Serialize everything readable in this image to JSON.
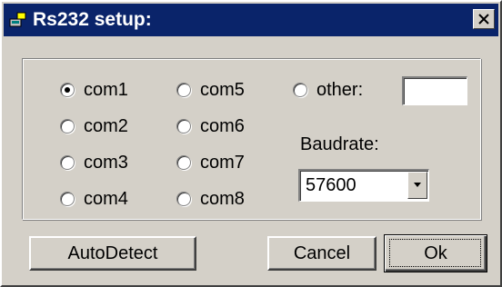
{
  "window": {
    "title": "Rs232 setup:",
    "icon": "serial-port-icon",
    "close_icon": "close-icon"
  },
  "ports": {
    "options": [
      {
        "label": "com1",
        "selected": true
      },
      {
        "label": "com2",
        "selected": false
      },
      {
        "label": "com3",
        "selected": false
      },
      {
        "label": "com4",
        "selected": false
      },
      {
        "label": "com5",
        "selected": false
      },
      {
        "label": "com6",
        "selected": false
      },
      {
        "label": "com7",
        "selected": false
      },
      {
        "label": "com8",
        "selected": false
      }
    ],
    "other": {
      "label": "other:",
      "selected": false,
      "value": ""
    }
  },
  "baudrate": {
    "label": "Baudrate:",
    "value": "57600"
  },
  "buttons": {
    "autodetect": "AutoDetect",
    "cancel": "Cancel",
    "ok": "Ok"
  },
  "colors": {
    "titlebar": "#0a246a",
    "face": "#d4d0c8"
  }
}
